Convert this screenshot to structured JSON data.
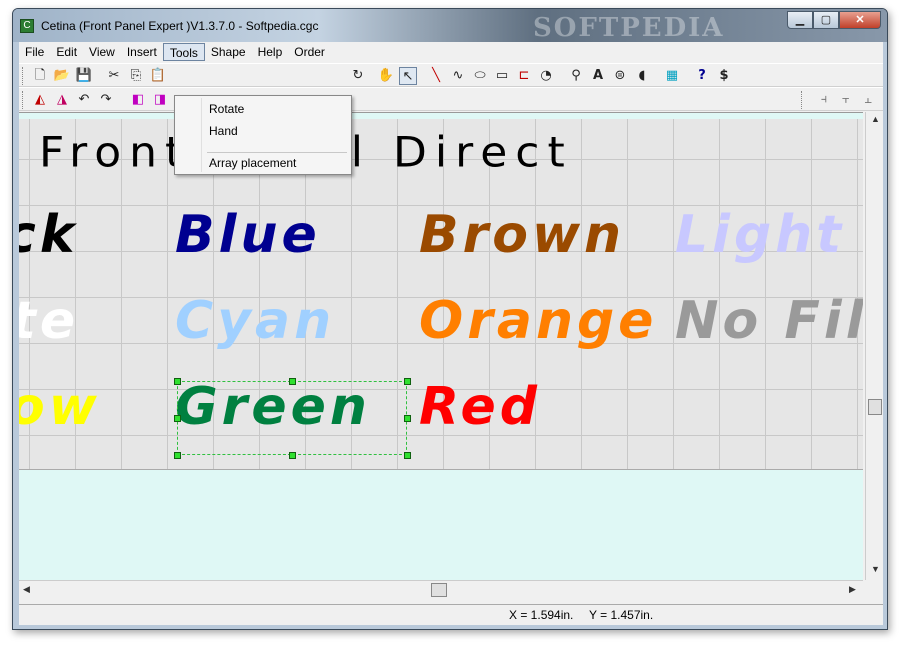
{
  "window": {
    "title": "Cetina (Front Panel Expert )V1.3.7.0 - Softpedia.cgc",
    "app_icon": "cetina-app-icon",
    "watermark": "SOFTPEDIA",
    "minimize_glyph": "▁",
    "maximize_glyph": "▢",
    "close_glyph": "✕"
  },
  "menubar": {
    "items": [
      "File",
      "Edit",
      "View",
      "Insert",
      "Tools",
      "Shape",
      "Help",
      "Order"
    ],
    "active": "Tools"
  },
  "tools_menu": {
    "items": [
      "Rotate",
      "Hand",
      "Array placement"
    ]
  },
  "toolbar1": {
    "icons": [
      {
        "name": "new-icon",
        "glyph": "🗋"
      },
      {
        "name": "open-icon",
        "glyph": "📂"
      },
      {
        "name": "save-icon",
        "glyph": "💾"
      },
      {
        "name": "cut-icon",
        "glyph": "✂"
      },
      {
        "name": "copy-icon",
        "glyph": "⎘"
      },
      {
        "name": "paste-icon",
        "glyph": "📋"
      },
      {
        "name": "redo-icon",
        "glyph": "↻"
      },
      {
        "name": "hand-icon",
        "glyph": "✋"
      },
      {
        "name": "pointer-icon",
        "glyph": "↖"
      },
      {
        "name": "line-icon",
        "glyph": "╲"
      },
      {
        "name": "curve-icon",
        "glyph": "∿"
      },
      {
        "name": "ellipse-icon",
        "glyph": "⬭"
      },
      {
        "name": "rectangle-icon",
        "glyph": "▭"
      },
      {
        "name": "rounded-rect-icon",
        "glyph": "⊏"
      },
      {
        "name": "arc-icon",
        "glyph": "◔"
      },
      {
        "name": "screw-icon",
        "glyph": "⚲"
      },
      {
        "name": "text-icon",
        "glyph": "A"
      },
      {
        "name": "countersink-icon",
        "glyph": "⊜"
      },
      {
        "name": "drill-icon",
        "glyph": "◖"
      },
      {
        "name": "array-icon",
        "glyph": "▦"
      },
      {
        "name": "help-icon",
        "glyph": "?"
      },
      {
        "name": "price-icon",
        "glyph": "$"
      }
    ]
  },
  "toolbar2": {
    "icons": [
      {
        "name": "flip-horizontal-icon",
        "glyph": "◭"
      },
      {
        "name": "flip-vertical-icon",
        "glyph": "◮"
      },
      {
        "name": "rotate-left-icon",
        "glyph": "↶"
      },
      {
        "name": "rotate-right-icon",
        "glyph": "↷"
      },
      {
        "name": "bring-front-icon",
        "glyph": "◧"
      },
      {
        "name": "send-back-icon",
        "glyph": "◨"
      },
      {
        "name": "align-left-icon",
        "glyph": "⫞"
      },
      {
        "name": "align-center-icon",
        "glyph": "⫟"
      },
      {
        "name": "align-right-icon",
        "glyph": "⫠"
      }
    ]
  },
  "canvas": {
    "heading": "Front Panel Direct",
    "labels": [
      {
        "text": "ck",
        "color": "#000000"
      },
      {
        "text": "Blue",
        "color": "#000090"
      },
      {
        "text": "Brown",
        "color": "#9a4a00"
      },
      {
        "text": "Light B",
        "color": "#c8c8ff"
      },
      {
        "text": "te",
        "color": "#ffffff"
      },
      {
        "text": "Cyan",
        "color": "#a0d0ff"
      },
      {
        "text": "Orange",
        "color": "#ff7f00"
      },
      {
        "text": "No Fill",
        "color": "#9a9a9a"
      },
      {
        "text": "ow",
        "color": "#ffff00"
      },
      {
        "text": "Green",
        "color": "#008040"
      },
      {
        "text": "Red",
        "color": "#ff0000"
      }
    ],
    "selected_label": "Green"
  },
  "statusbar": {
    "x": "X = 1.594in.",
    "y": "Y = 1.457in."
  },
  "colors": {
    "canvas_bg": "#e6e6e6",
    "panel_margin": "#dff8f5",
    "selection_handle": "#30e030"
  }
}
